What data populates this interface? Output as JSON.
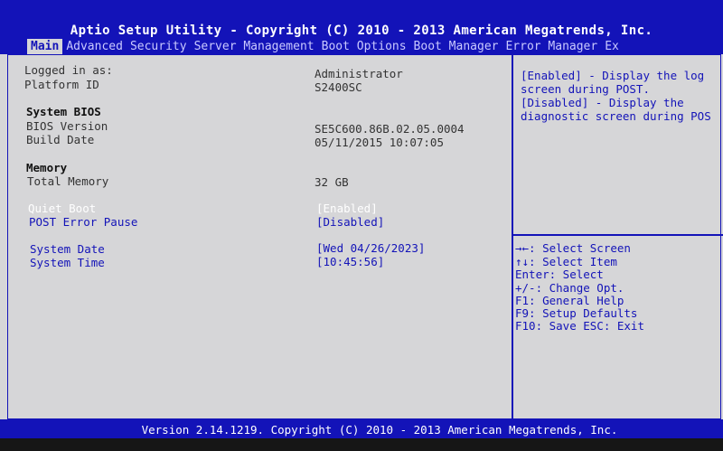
{
  "header": {
    "title": "Aptio Setup Utility - Copyright (C) 2010 - 2013 American Megatrends, Inc."
  },
  "tabs": [
    "Main",
    "Advanced",
    "Security",
    "Server Management",
    "Boot Options",
    "Boot Manager",
    "Error Manager",
    "Ex"
  ],
  "main": {
    "logged_in_label": "Logged in as:",
    "logged_in_value": "Administrator",
    "platform_label": "Platform ID",
    "platform_value": "S2400SC",
    "system_bios_header": "System BIOS",
    "bios_version_label": "BIOS Version",
    "bios_version_value": "SE5C600.86B.02.05.0004",
    "build_date_label": "Build Date",
    "build_date_value": "05/11/2015 10:07:05",
    "memory_header": "Memory",
    "total_memory_label": "Total Memory",
    "total_memory_value": "32 GB",
    "quiet_boot_label": "Quiet Boot",
    "quiet_boot_value": "[Enabled]",
    "post_error_label": "POST Error Pause",
    "post_error_value": "[Disabled]",
    "system_date_label": "System Date",
    "system_date_value": "[Wed 04/26/2023]",
    "system_time_label": "System Time",
    "system_time_value": "[10:45:56]"
  },
  "help": {
    "description": [
      "[Enabled] - Display the log",
      "screen during POST.",
      "[Disabled] - Display the",
      "diagnostic screen during POS"
    ],
    "keys": [
      "→←: Select Screen",
      "↑↓: Select Item",
      "Enter: Select",
      "+/-: Change Opt.",
      "F1: General Help",
      "F9: Setup Defaults",
      "F10: Save  ESC: Exit"
    ]
  },
  "footer": {
    "version": "Version 2.14.1219. Copyright (C) 2010 - 2013 American Megatrends, Inc."
  },
  "colors": {
    "bios_blue": "#1313b8",
    "panel_gray": "#d6d6d8",
    "selected_text": "#ffffff"
  }
}
